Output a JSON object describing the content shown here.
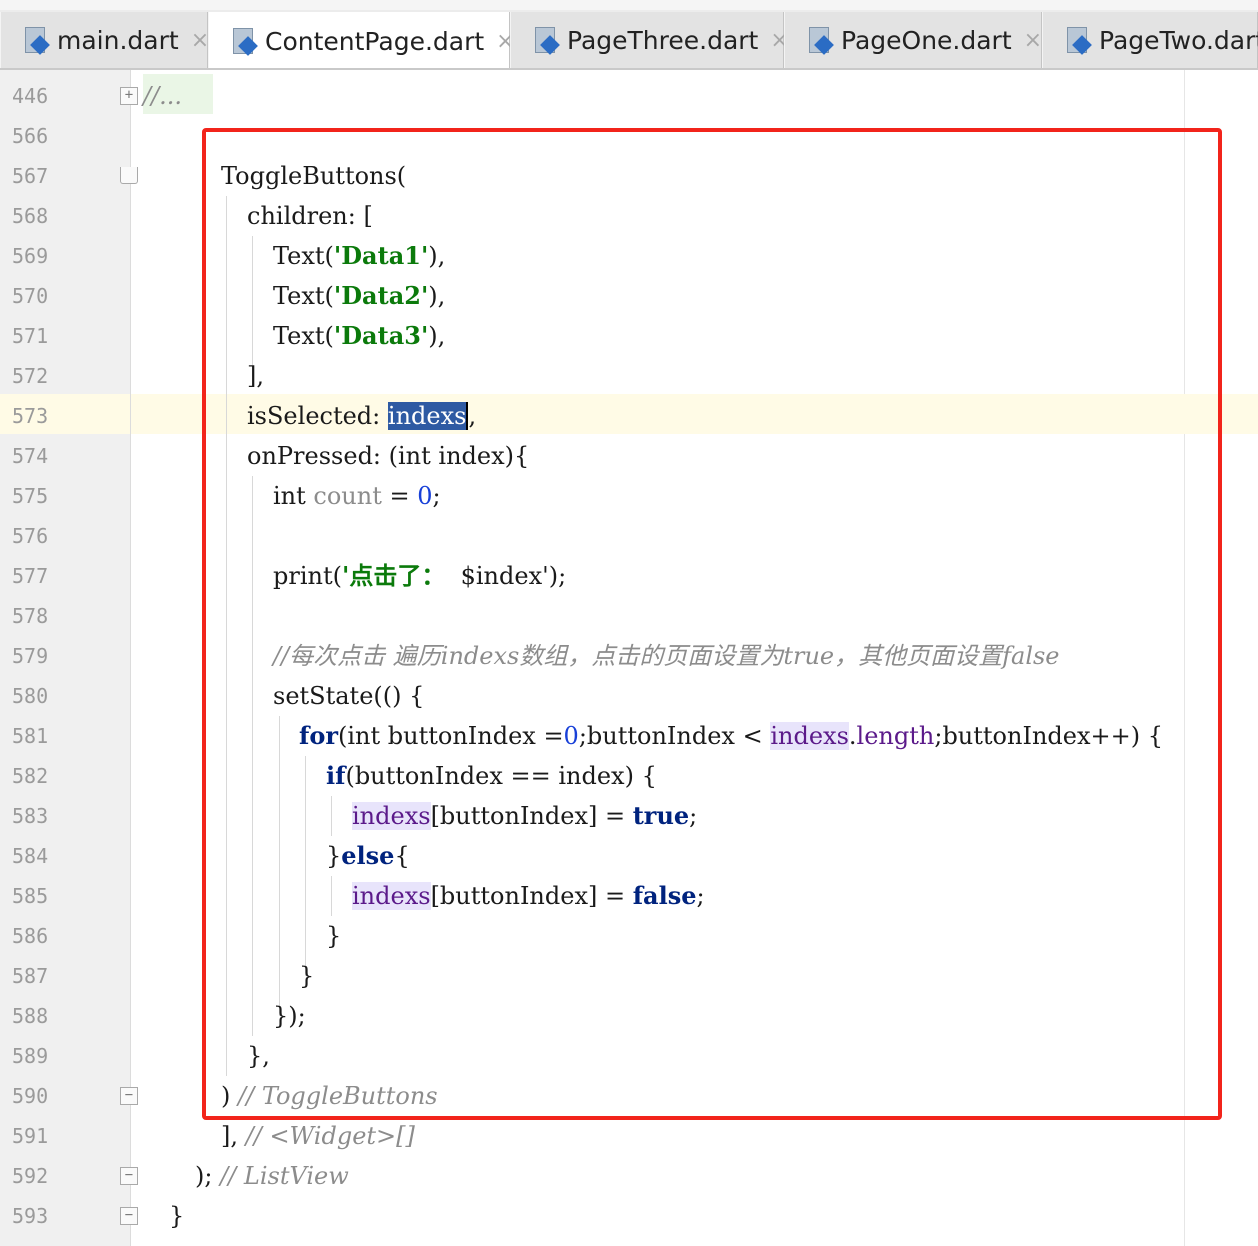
{
  "tabs": [
    {
      "label": "main.dart",
      "close": "×",
      "active": false
    },
    {
      "label": "ContentPage.dart",
      "close": "×",
      "active": true
    },
    {
      "label": "PageThree.dart",
      "close": "×",
      "active": false
    },
    {
      "label": "PageOne.dart",
      "close": "×",
      "active": false
    },
    {
      "label": "PageTwo.dart",
      "close": "",
      "active": false
    }
  ],
  "editor": {
    "fold_placeholder": "//...",
    "lines": [
      {
        "n": "446"
      },
      {
        "n": "566"
      },
      {
        "n": "567"
      },
      {
        "n": "568"
      },
      {
        "n": "569"
      },
      {
        "n": "570"
      },
      {
        "n": "571"
      },
      {
        "n": "572"
      },
      {
        "n": "573"
      },
      {
        "n": "574"
      },
      {
        "n": "575"
      },
      {
        "n": "576"
      },
      {
        "n": "577"
      },
      {
        "n": "578"
      },
      {
        "n": "579"
      },
      {
        "n": "580"
      },
      {
        "n": "581"
      },
      {
        "n": "582"
      },
      {
        "n": "583"
      },
      {
        "n": "584"
      },
      {
        "n": "585"
      },
      {
        "n": "586"
      },
      {
        "n": "587"
      },
      {
        "n": "588"
      },
      {
        "n": "589"
      },
      {
        "n": "590"
      },
      {
        "n": "591"
      },
      {
        "n": "592"
      },
      {
        "n": "593"
      }
    ],
    "code": {
      "l567": "ToggleButtons(",
      "l568": "children: [",
      "text_call": "Text(",
      "text_close": "),",
      "d1": "'Data1'",
      "d2": "'Data2'",
      "d3": "'Data3'",
      "l572": "],",
      "l573_key": "isSelected: ",
      "l573_val": "indexs",
      "l573_end": ",",
      "l574": "onPressed: (int index){",
      "l575_type": "int ",
      "l575_var": "count",
      "l575_eq": " = ",
      "l575_num": "0",
      "l575_end": ";",
      "l577_call": "print(",
      "l577_str": "'点击了：",
      "l577_rest": "  $index'",
      "l577_end": ");",
      "l579_comment": "//每次点击 遍历indexs数组，点击的页面设置为true，其他页面设置false",
      "l580": "setState(() {",
      "l581_for": "for",
      "l581_a": "(int buttonIndex =",
      "l581_zero": "0",
      "l581_b": ";buttonIndex < ",
      "l581_ident": "indexs",
      "l581_dot": ".",
      "l581_len": "length",
      "l581_c": ";buttonIndex++) {",
      "l582_if": "if",
      "l582_rest": "(buttonIndex == index) {",
      "l583_ident": "indexs",
      "l583_mid": "[buttonIndex] = ",
      "l583_true": "true",
      "l583_end": ";",
      "l584_open": "}",
      "l584_else": "else",
      "l584_close": "{",
      "l585_ident": "indexs",
      "l585_mid": "[buttonIndex] = ",
      "l585_false": "false",
      "l585_end": ";",
      "l586": "}",
      "l587": "}",
      "l588": "});",
      "l589": "},",
      "l590_code": ")",
      "l590_comment": "// ToggleButtons",
      "l591_code": "],",
      "l591_comment": "// <Widget>[]",
      "l592_code": ");",
      "l592_comment": "// ListView",
      "l593": "}"
    }
  },
  "colors": {
    "highlight_box": "#f2241b",
    "selection": "#2e5aa3",
    "string": "#0b7a0b",
    "keyword": "#00237e",
    "caret_row": "#fffbe6"
  }
}
